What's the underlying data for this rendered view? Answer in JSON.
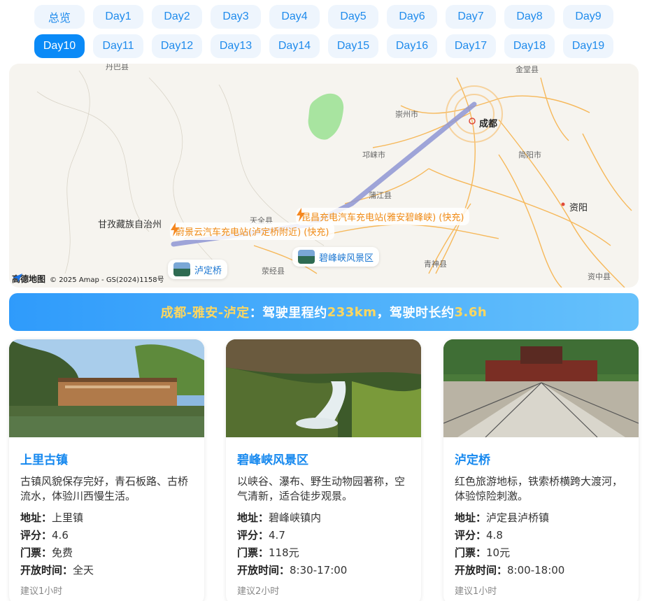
{
  "tabs": {
    "row1": [
      "总览",
      "Day1",
      "Day2",
      "Day3",
      "Day4",
      "Day5",
      "Day6",
      "Day7",
      "Day8",
      "Day9"
    ],
    "row2": [
      "Day10",
      "Day11",
      "Day12",
      "Day13",
      "Day14",
      "Day15",
      "Day16",
      "Day17",
      "Day18",
      "Day19"
    ],
    "active": "Day10"
  },
  "map": {
    "labels": {
      "danba": "丹巴县",
      "jintang": "金堂县",
      "chongzhou": "崇州市",
      "chengdu": "成都",
      "qionglai": "邛崃市",
      "jianyang": "简阳市",
      "pujiang": "蒲江县",
      "ziyang": "资阳",
      "ganzi": "甘孜藏族自治州",
      "tianquan": "天全县",
      "qingshen": "青神县",
      "yingjing": "荥经县",
      "zizhong": "资中县"
    },
    "charge_stations": {
      "ya_an": "昆昌充电汽车充电站(雅安碧峰峡) (快充)",
      "luding": "蔚景云汽车充电站(泸定桥附近) (快充)"
    },
    "pois": {
      "bifengxia": "碧峰峡风景区",
      "ludingqiao": "泸定桥"
    },
    "brand": "高德地图",
    "copyright": "© 2025 Amap - GS(2024)1158号",
    "route_color": "#8e95d4"
  },
  "summary": {
    "route": "成都-雅安-泸定",
    "text1": "：驾驶里程约",
    "distance": "233km",
    "text2": "，驾驶时长约",
    "duration": "3.6h"
  },
  "cards": [
    {
      "title": "上里古镇",
      "desc": "古镇风貌保存完好，青石板路、古桥流水，体验川西慢生活。",
      "address_label": "地址：",
      "address": "上里镇",
      "rating_label": "评分：",
      "rating": "4.6",
      "ticket_label": "门票：",
      "ticket": "免费",
      "hours_label": "开放时间：",
      "hours": "全天",
      "tip": "建议1小时"
    },
    {
      "title": "碧峰峡风景区",
      "desc": "以峡谷、瀑布、野生动物园著称，空气清新，适合徒步观景。",
      "address_label": "地址：",
      "address": "碧峰峡镇内",
      "rating_label": "评分：",
      "rating": "4.7",
      "ticket_label": "门票：",
      "ticket": "118元",
      "hours_label": "开放时间：",
      "hours": "8:30-17:00",
      "tip": "建议2小时"
    },
    {
      "title": "泸定桥",
      "desc": "红色旅游地标，铁索桥横跨大渡河，体验惊险刺激。",
      "address_label": "地址：",
      "address": "泸定县泸桥镇",
      "rating_label": "评分：",
      "rating": "4.8",
      "ticket_label": "门票：",
      "ticket": "10元",
      "hours_label": "开放时间：",
      "hours": "8:00-18:00",
      "tip": "建议1小时"
    }
  ]
}
